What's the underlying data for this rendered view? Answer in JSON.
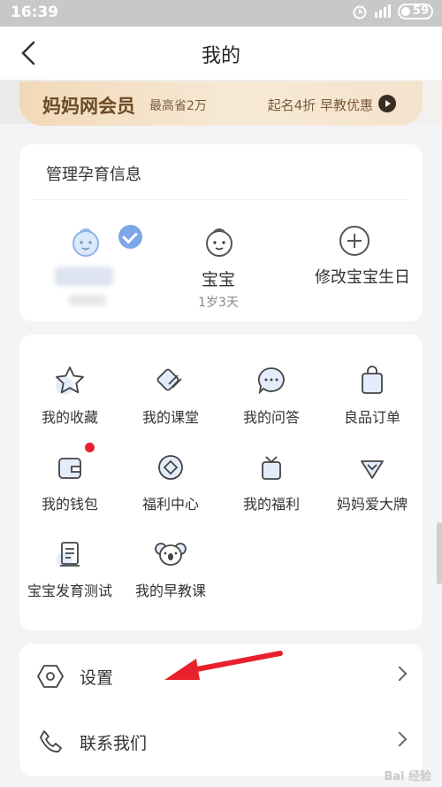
{
  "status": {
    "time": "16:39",
    "battery": "59"
  },
  "nav": {
    "title": "我的"
  },
  "banner": {
    "name": "妈妈网会员",
    "save": "最高省2万",
    "promo": "起名4折 早教优惠"
  },
  "babyinfo": {
    "header": "管理孕育信息",
    "baby": {
      "name": "宝宝",
      "age": "1岁3天"
    },
    "modify": "修改宝宝生日"
  },
  "grid": [
    {
      "label": "我的收藏",
      "icon": "star-icon"
    },
    {
      "label": "我的课堂",
      "icon": "classroom-icon"
    },
    {
      "label": "我的问答",
      "icon": "chat-icon"
    },
    {
      "label": "良品订单",
      "icon": "shopping-bag-icon"
    },
    {
      "label": "我的钱包",
      "icon": "wallet-icon"
    },
    {
      "label": "福利中心",
      "icon": "diamond-coin-icon"
    },
    {
      "label": "我的福利",
      "icon": "gift-icon"
    },
    {
      "label": "妈妈爱大牌",
      "icon": "brand-diamond-icon"
    },
    {
      "label": "宝宝发育测试",
      "icon": "test-book-icon"
    },
    {
      "label": "我的早教课",
      "icon": "koala-icon"
    }
  ],
  "settings": [
    {
      "label": "设置",
      "icon": "settings-hexagon-icon"
    },
    {
      "label": "联系我们",
      "icon": "phone-icon"
    }
  ],
  "watermark": "Bai 经验",
  "colors": {
    "accent": "#7da6e8",
    "badge": "#e8212c",
    "arrow": "#e8212c",
    "vip": "#6b4a26"
  }
}
